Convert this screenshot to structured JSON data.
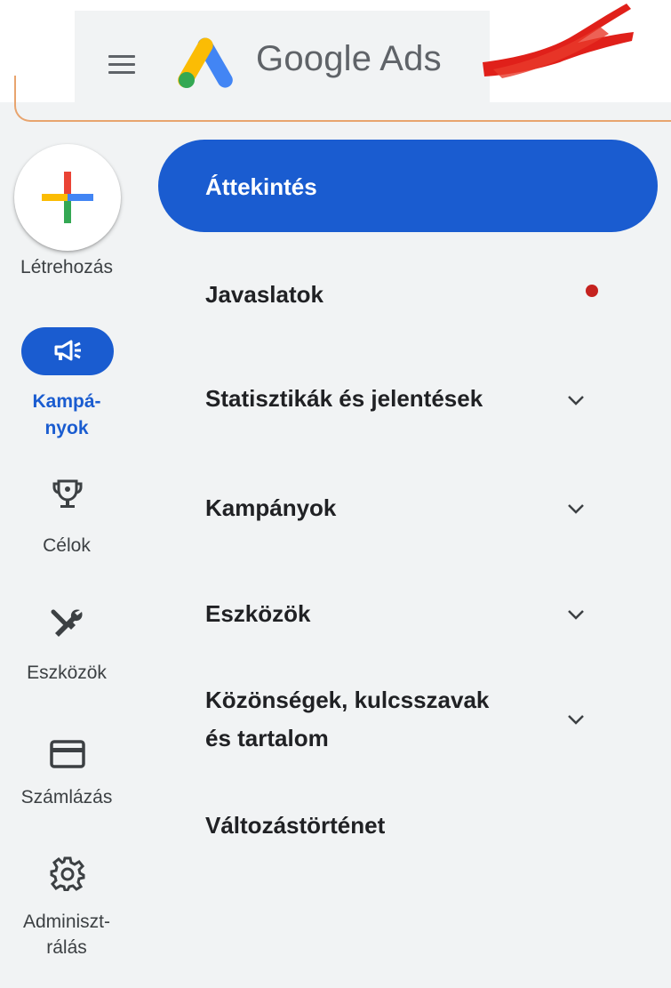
{
  "header": {
    "brand_google": "Google",
    "brand_ads": "Ads"
  },
  "rail": {
    "create_label": "Létrehozás",
    "campaigns_label_1": "Kampá-",
    "campaigns_label_2": "nyok",
    "goals_label": "Célok",
    "tools_label": "Eszközök",
    "billing_label": "Számlázás",
    "admin_label_1": "Adminiszt-",
    "admin_label_2": "rálás"
  },
  "nav": {
    "overview": "Áttekintés",
    "recommendations": "Javaslatok",
    "insights_line": "Statisztikák és jelentések",
    "campaigns": "Kampányok",
    "assets": "Eszközök",
    "audiences_line1": "Közönségek, kulcsszavak",
    "audiences_line2": "és tartalom",
    "change_history": "Változástörténet"
  },
  "colors": {
    "active_blue": "#1a5cd0",
    "panel_gray": "#f1f3f4",
    "notification_red": "#c5221f"
  },
  "icons": {
    "menu": "hamburger-menu-icon",
    "logo": "google-ads-logo",
    "create": "plus-icon",
    "campaigns": "megaphone-icon",
    "goals": "trophy-icon",
    "tools": "wrench-screwdriver-icon",
    "billing": "credit-card-icon",
    "admin": "gear-icon",
    "expand": "chevron-down-icon"
  }
}
